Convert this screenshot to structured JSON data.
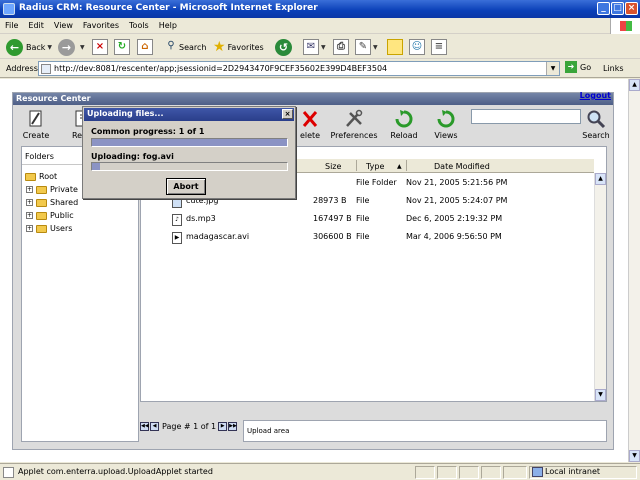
{
  "window": {
    "title": "Radius CRM: Resource Center - Microsoft Internet Explorer",
    "minimize": "_",
    "maximize": "□",
    "close": "×"
  },
  "menu": [
    "File",
    "Edit",
    "View",
    "Favorites",
    "Tools",
    "Help"
  ],
  "toolbar": {
    "back": "Back",
    "search": "Search",
    "favorites": "Favorites"
  },
  "address": {
    "label": "Address",
    "url": "http://dev:8081/rescenter/app;jsessionid=2D2943470F9CEF35602E399D4BEF3504",
    "go": "Go",
    "links": "Links"
  },
  "rc": {
    "title": "Resource Center",
    "logout": "Logout",
    "tools": [
      {
        "label": "Create",
        "icon": "create-icon"
      },
      {
        "label": "Rena",
        "icon": "rename-icon"
      },
      {
        "label": "elete",
        "icon": "delete-icon"
      },
      {
        "label": "Preferences",
        "icon": "preferences-icon"
      },
      {
        "label": "Reload",
        "icon": "reload-icon"
      },
      {
        "label": "Views",
        "icon": "views-icon"
      },
      {
        "label": "Search",
        "icon": "search-icon"
      }
    ],
    "search_value": "",
    "folders": {
      "header": "Folders",
      "root": "Root",
      "children": [
        "Private",
        "Shared",
        "Public",
        "Users"
      ]
    },
    "columns": {
      "size": "Size",
      "type": "Type",
      "date": "Date Modified"
    },
    "files": [
      {
        "name": "",
        "size": "",
        "type": "File Folder",
        "date": "Nov 21, 2005 5:21:56 PM"
      },
      {
        "name": "cute.jpg",
        "size": "28973 B",
        "type": "File",
        "date": "Nov 21, 2005 5:24:07 PM"
      },
      {
        "name": "ds.mp3",
        "size": "167497 B",
        "type": "File",
        "date": "Dec 6, 2005 2:19:32 PM"
      },
      {
        "name": "madagascar.avi",
        "size": "306600 B",
        "type": "File",
        "date": "Mar 4, 2006 9:56:50 PM"
      }
    ],
    "pager": "Page # 1 of 1",
    "upload_area": "Upload area"
  },
  "dialog": {
    "title": "Uploading files...",
    "common_label": "Common progress: 1 of 1",
    "common_progress": 1.0,
    "file_label": "Uploading: fog.avi",
    "file_progress": 0.04,
    "abort": "Abort"
  },
  "status": {
    "text": "Applet com.enterra.upload.UploadApplet started",
    "zone": "Local intranet"
  }
}
